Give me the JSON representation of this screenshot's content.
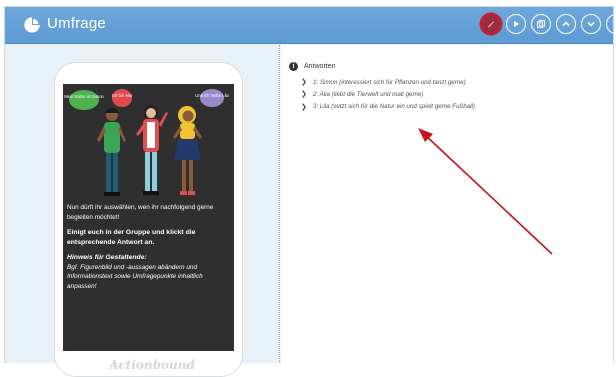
{
  "header": {
    "title": "Umfrage",
    "icon": "pie-chart-icon",
    "tools": [
      {
        "name": "edit-icon",
        "state": "active"
      },
      {
        "name": "play-icon"
      },
      {
        "name": "copy-icon"
      },
      {
        "name": "chevron-up-icon"
      },
      {
        "name": "chevron-down-icon"
      },
      {
        "name": "trash-icon"
      }
    ]
  },
  "preview": {
    "bubbles": [
      "Mein Name ist Simon",
      "Ich bin Alia",
      "Und ich heiße Lila"
    ],
    "intro": "Nun dürft ihr auswählen, wen ihr nachfolgend gerne begleiten möchtet!",
    "instruction": "Einigt euch in der Gruppe und klickt die entsprechende Antwort an.",
    "hint_title": "Hinweis für Gestaltende:",
    "hint_text": "Bgf. Figurenbild und -aussagen abändern und Informationstext sowie Umfragepunkte inhaltlich anpassen!",
    "watermark": "Actionbound"
  },
  "answers_section": {
    "label": "Antworten",
    "items": [
      "1: Simon (interessiert sich für Pflanzen und tanzt gerne)",
      "2: Alia (liebt die Tierwelt und malt gerne)",
      "3: Lila (setzt sich für die Natur ein und spielt gerne Fußball)"
    ]
  },
  "colors": {
    "header": "#5e9bd3",
    "panel_bg": "#e9f1f8",
    "screen": "#2f2f2f",
    "active_tool": "#c62030",
    "arrow": "#c8101e"
  }
}
